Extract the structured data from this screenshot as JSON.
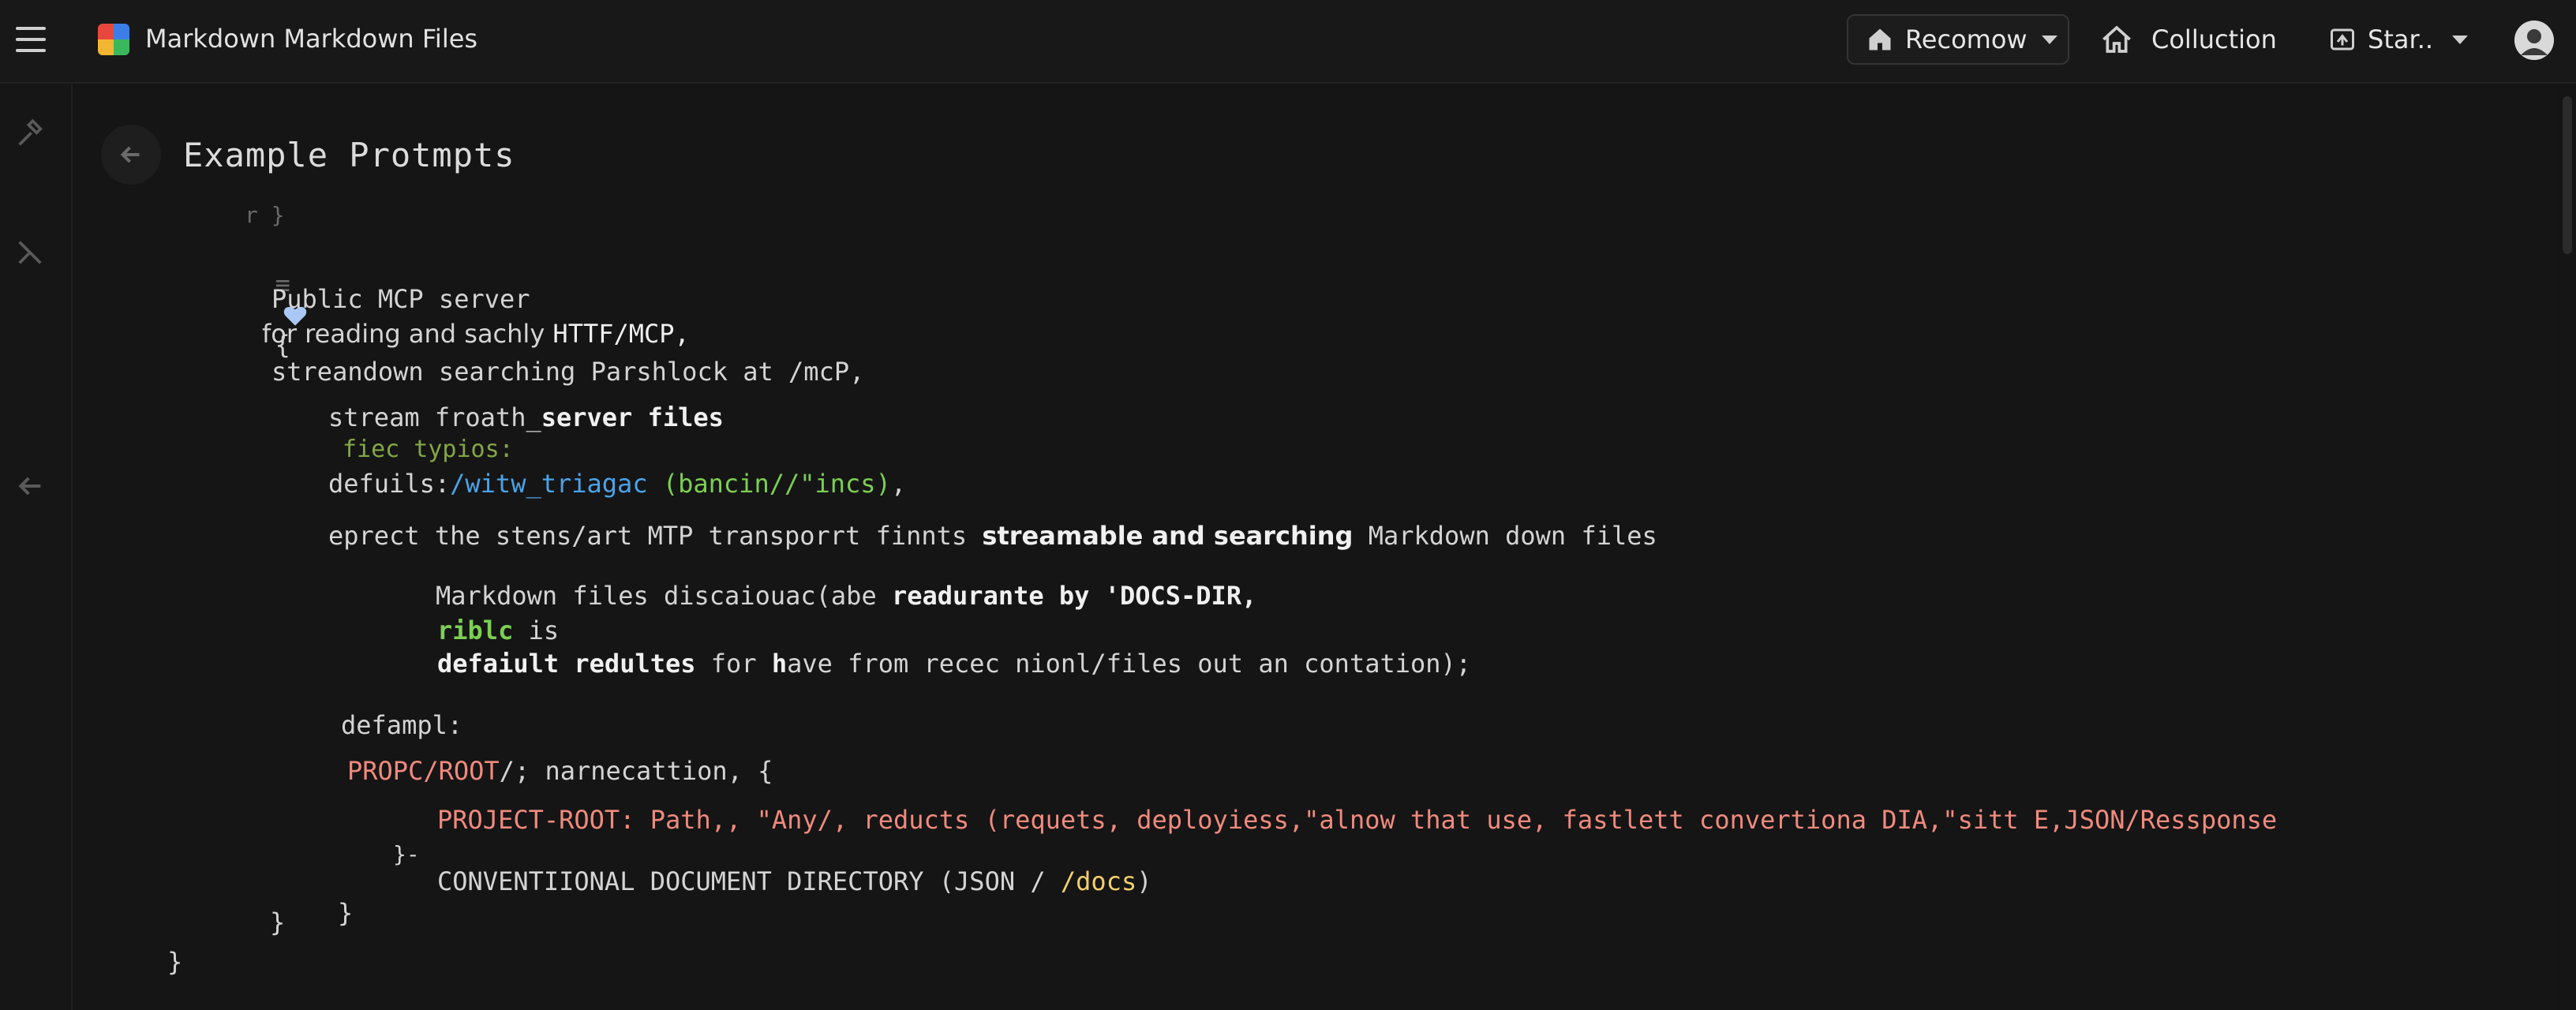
{
  "topbar": {
    "app_title": "Markdown Markdown Files",
    "recomow_label": "Recomow",
    "collection_label": "Colluction",
    "star_label": "Star.."
  },
  "panel": {
    "title": "Example Protmpts"
  },
  "code": {
    "l1": "r }",
    "l2_prefix": "≡",
    "l2_brace": "{",
    "l3": "Public MCP server",
    "l4a": "for reading and sachly ",
    "l4b": "HTTF/MCP,",
    "l5": "streandown searching Parshlock at /mcP,",
    "l6a": "stream froath_",
    "l6b": "server files",
    "l7": "fiec typios:",
    "l8a": "defuils:",
    "l8b": "/witw_triagac",
    "l8c": " (bancin//\"incs)",
    "l8d": ",",
    "l9a": "eprect the stens/art MTP transporrt finnts ",
    "l9b": "streamable and searching",
    "l9c": " Markdown down files",
    "l10a": "Markdown files discaiouac(abe ",
    "l10b": "readurante by 'DOCS-DIR,",
    "l11a": "riblc",
    "l11b": " is",
    "l12a": "defaiult ",
    "l12b": "redultes",
    "l12c": " for ",
    "l12d": "h",
    "l12e": "ave from recec nionl/files out an contation);",
    "l13": "defampl:",
    "l14a": "PROPC/ROOT",
    "l14b": "/; narnecattion, {",
    "l15": "PROJECT-ROOT: Path,, \"Any/, reducts (requets, deployiess,\"alnow that use, fastlett convertiona DIA,\"sitt E,JSON/Ressponse",
    "l16": "}-",
    "l17a": "CONVENTIIONAL DOCUMENT DIRECTORY (JSON / ",
    "l17b": "/docs",
    "l17c": ")",
    "l18a": "}",
    "l18b": "}",
    "l19": "}"
  },
  "icons": {
    "menu": "hamburger-icon",
    "back": "arrow-left-icon",
    "home": "home-icon",
    "heart": "heart-icon"
  },
  "colors": {
    "accent_blue": "#4aa3e8",
    "green": "#7ccf52",
    "red": "#f08a7e",
    "yellow": "#f2d06b"
  }
}
